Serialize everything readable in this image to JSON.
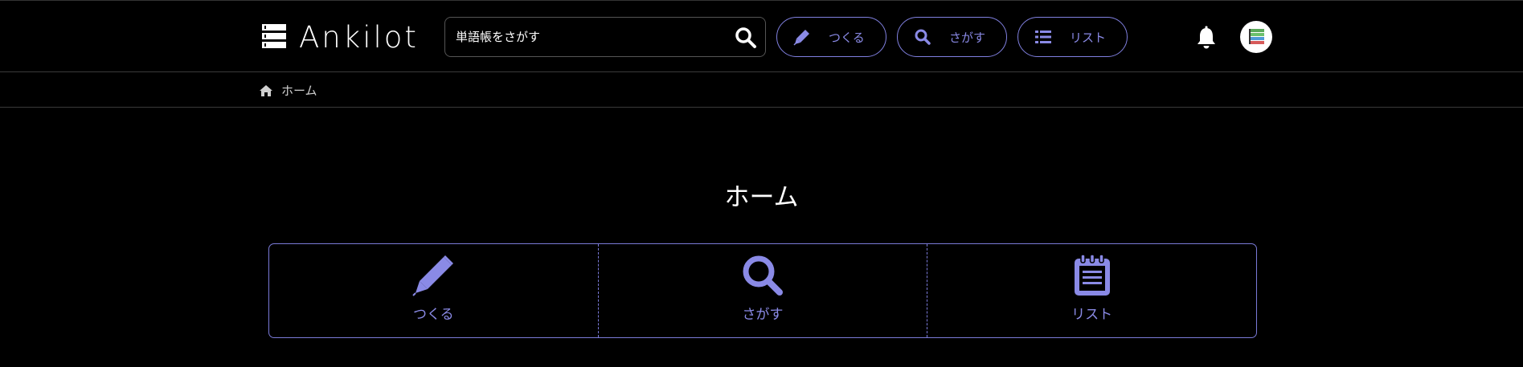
{
  "header": {
    "logo_text": "Ankilot",
    "search": {
      "placeholder": "単語帳をさがす",
      "value": ""
    },
    "nav": [
      {
        "label": "つくる",
        "icon": "pencil-icon"
      },
      {
        "label": "さがす",
        "icon": "search-icon"
      },
      {
        "label": "リスト",
        "icon": "list-icon"
      }
    ]
  },
  "breadcrumb": {
    "home_label": "ホーム"
  },
  "main": {
    "title": "ホーム",
    "actions": [
      {
        "label": "つくる",
        "icon": "pencil-icon"
      },
      {
        "label": "さがす",
        "icon": "search-icon"
      },
      {
        "label": "リスト",
        "icon": "notepad-icon"
      }
    ]
  },
  "colors": {
    "background": "#000000",
    "accent": "#8080e0",
    "text": "#ffffff"
  }
}
